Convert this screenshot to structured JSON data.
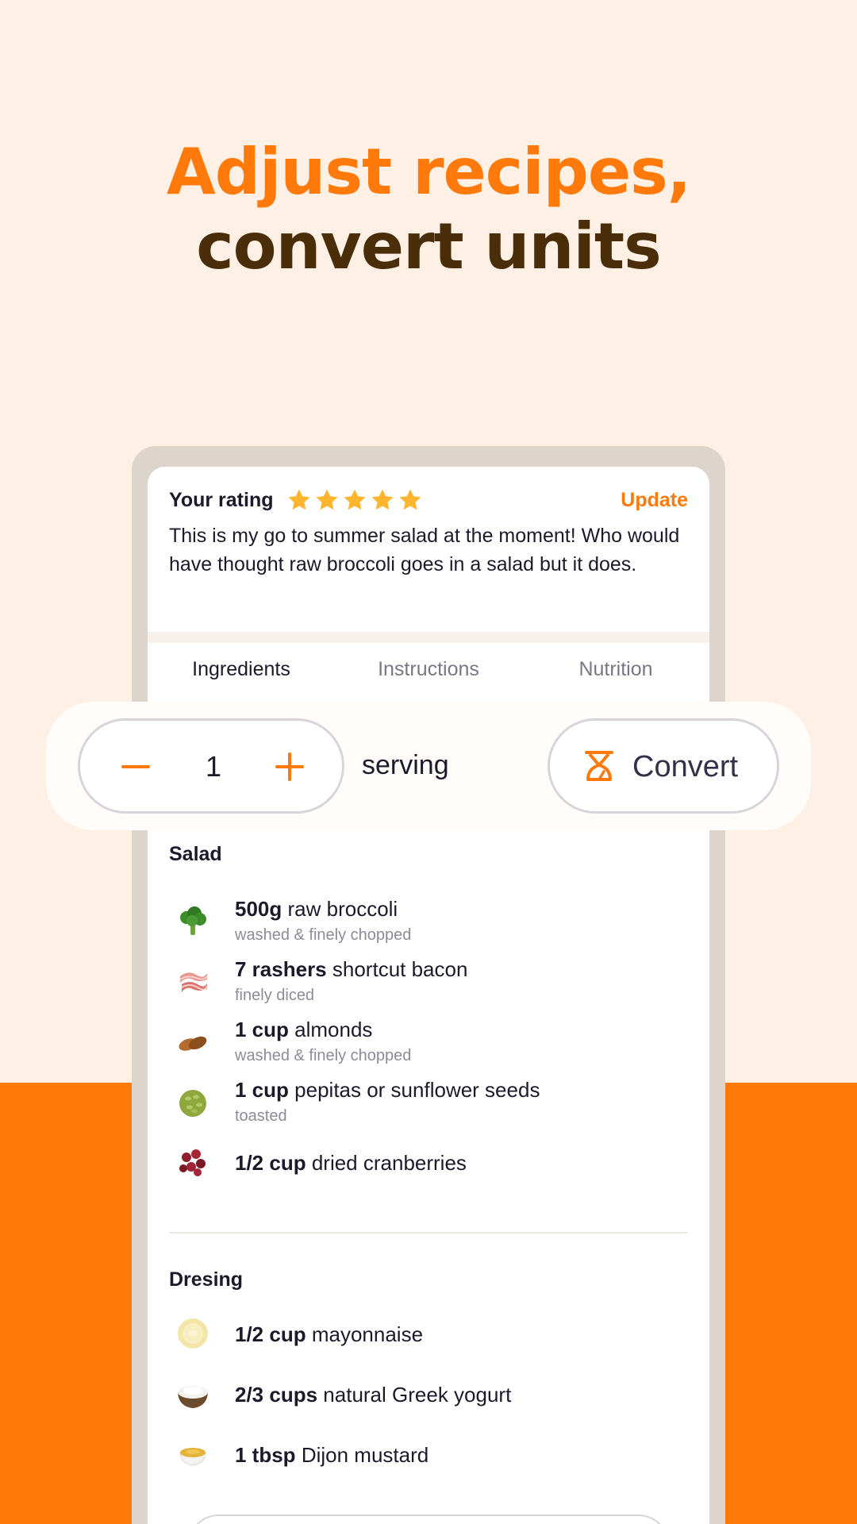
{
  "headline": {
    "line1": "Adjust recipes,",
    "line2": "convert units"
  },
  "colors": {
    "accent": "#FF7A0A",
    "headline_dark": "#4A2E0A",
    "background": "#FFF0E5",
    "star": "#FFB52E"
  },
  "rating": {
    "label": "Your rating",
    "stars": 5,
    "update_label": "Update",
    "review": "This is my go to summer salad at the moment! Who would have thought raw broccoli goes in a salad but it does."
  },
  "tabs": [
    {
      "label": "Ingredients",
      "active": true
    },
    {
      "label": "Instructions",
      "active": false
    },
    {
      "label": "Nutrition",
      "active": false
    }
  ],
  "servings": {
    "count": "1",
    "label": "serving",
    "decrement_icon": "minus-icon",
    "increment_icon": "plus-icon"
  },
  "convert": {
    "label": "Convert",
    "icon": "scale-icon"
  },
  "sections": [
    {
      "title": "Salad",
      "items": [
        {
          "qty": "500g",
          "name": "raw broccoli",
          "note": "washed & finely chopped",
          "icon": "broccoli-icon"
        },
        {
          "qty": "7 rashers",
          "name": "shortcut bacon",
          "note": "finely diced",
          "icon": "bacon-icon"
        },
        {
          "qty": "1 cup",
          "name": "almonds",
          "note": "washed & finely chopped",
          "icon": "almond-icon"
        },
        {
          "qty": "1 cup",
          "name": "pepitas or sunflower seeds",
          "note": "toasted",
          "icon": "seeds-icon"
        },
        {
          "qty": "1/2 cup",
          "name": "dried cranberries",
          "note": "",
          "icon": "cranberry-icon"
        }
      ]
    },
    {
      "title": "Dresing",
      "items": [
        {
          "qty": "1/2 cup",
          "name": "mayonnaise",
          "note": "",
          "icon": "mayonnaise-icon"
        },
        {
          "qty": "2/3 cups",
          "name": "natural Greek yogurt",
          "note": "",
          "icon": "yogurt-icon"
        },
        {
          "qty": "1 tbsp",
          "name": "Dijon mustard",
          "note": "",
          "icon": "mustard-icon"
        }
      ]
    }
  ]
}
